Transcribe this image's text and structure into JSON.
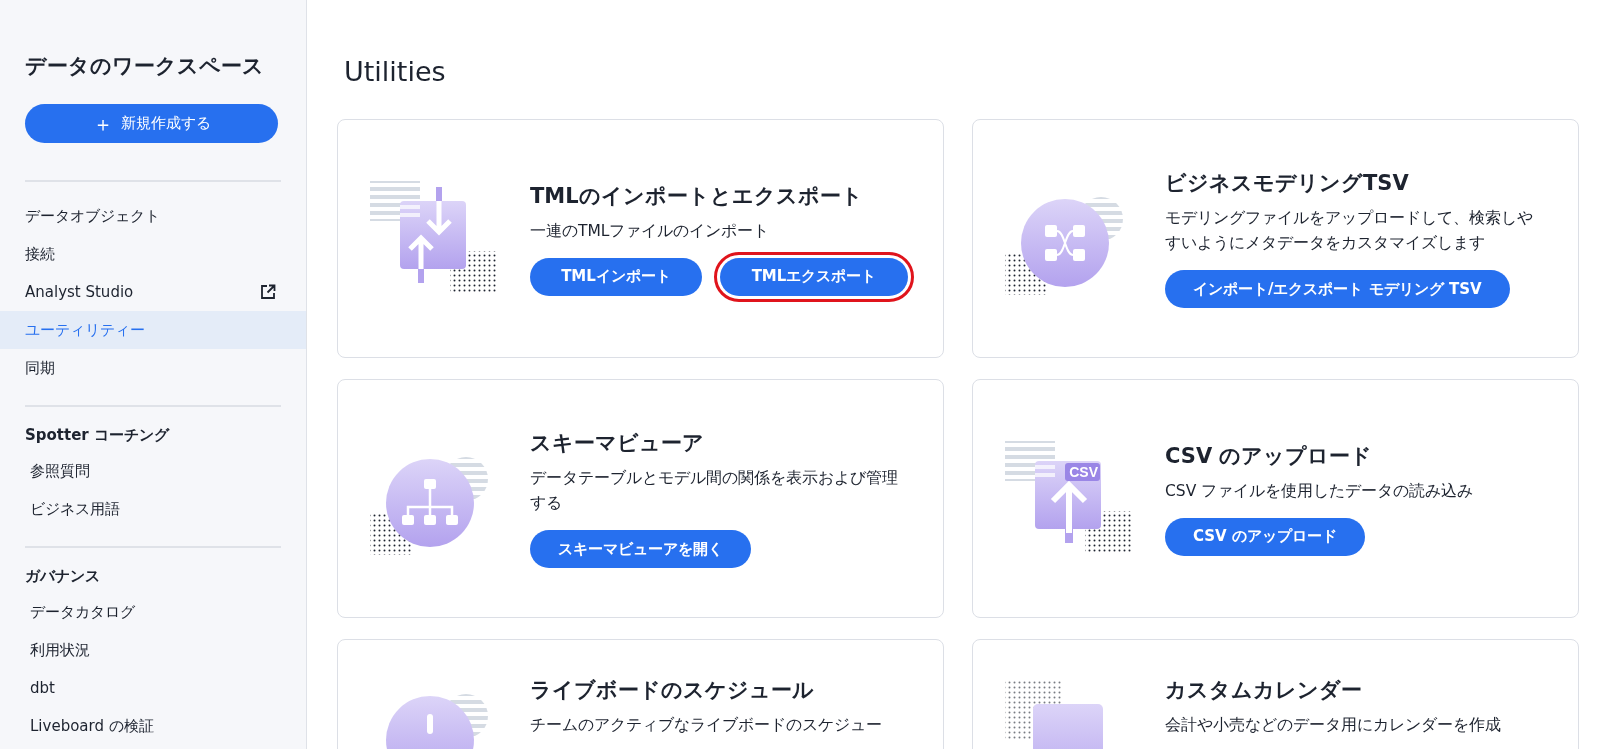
{
  "sidebar": {
    "title": "データのワークスペース",
    "new_button": {
      "icon": "＋",
      "label": "新規作成する"
    },
    "groups": [
      {
        "items": [
          {
            "label": "データオブジェクト",
            "selected": false,
            "external": false
          },
          {
            "label": "接続",
            "selected": false,
            "external": false
          },
          {
            "label": "Analyst Studio",
            "selected": false,
            "external": true
          },
          {
            "label": "ユーティリティー",
            "selected": true,
            "external": false
          },
          {
            "label": "同期",
            "selected": false,
            "external": false
          }
        ]
      },
      {
        "heading": "Spotter コーチング",
        "items": [
          {
            "label": "参照質問",
            "selected": false,
            "external": false
          },
          {
            "label": "ビジネス用語",
            "selected": false,
            "external": false
          }
        ]
      },
      {
        "heading": "ガバナンス",
        "items": [
          {
            "label": "データカタログ",
            "selected": false,
            "external": false
          },
          {
            "label": "利用状況",
            "selected": false,
            "external": false
          },
          {
            "label": "dbt",
            "selected": false,
            "external": false
          },
          {
            "label": "Liveboard の検証",
            "selected": false,
            "external": false
          }
        ]
      }
    ]
  },
  "page_title": "Utilities",
  "cards": [
    {
      "kind": "docs-arrows",
      "title": "TMLのインポートとエクスポート",
      "description": "一連のTMLファイルのインポート",
      "buttons": [
        {
          "label": "TMLインポート",
          "highlighted": false
        },
        {
          "label": "TMLエクスポート",
          "highlighted": true
        }
      ]
    },
    {
      "kind": "network-circle",
      "title": "ビジネスモデリングTSV",
      "description": "モデリングファイルをアップロードして、検索しやすいようにメタデータをカスタマイズします",
      "buttons": [
        {
          "label": "インポート/エクスポート モデリング TSV",
          "highlighted": false
        }
      ]
    },
    {
      "kind": "hierarchy-circle",
      "title": "スキーマビューア",
      "description": "データテーブルとモデル間の関係を表示および管理する",
      "buttons": [
        {
          "label": "スキーマビューアを開く",
          "highlighted": false
        }
      ]
    },
    {
      "kind": "csv-upload",
      "title": "CSV のアップロード",
      "description": "CSV ファイルを使用したデータの読み込み",
      "badge": "CSV",
      "buttons": [
        {
          "label": "CSV のアップロード",
          "highlighted": false
        }
      ]
    },
    {
      "kind": "schedule-circle",
      "title": "ライブボードのスケジュール",
      "description": "チームのアクティブなライブボードのスケジュー"
    },
    {
      "kind": "calendar",
      "title": "カスタムカレンダー",
      "description": "会計や小売などのデータ用にカレンダーを作成"
    }
  ]
}
